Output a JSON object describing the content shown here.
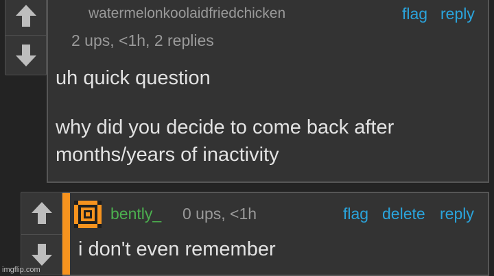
{
  "comments": [
    {
      "username": "watermelonkoolaidfriedchicken",
      "meta": "2 ups, <1h, 2 replies",
      "actions": {
        "flag": "flag",
        "reply": "reply"
      },
      "body_lines": [
        "uh quick question",
        "",
        "why did you decide to come back after",
        "months/years of inactivity"
      ]
    },
    {
      "username": "bently_",
      "username_color": "#4cb04f",
      "meta": "0 ups, <1h",
      "actions": {
        "flag": "flag",
        "delete": "delete",
        "reply": "reply"
      },
      "body": "i don't even remember",
      "accent_color": "#f7931e"
    }
  ],
  "icons": {
    "upvote": "arrow-up-icon",
    "downvote": "arrow-down-icon",
    "avatar": "pixel-avatar-icon"
  },
  "watermark": "imgflip.com"
}
